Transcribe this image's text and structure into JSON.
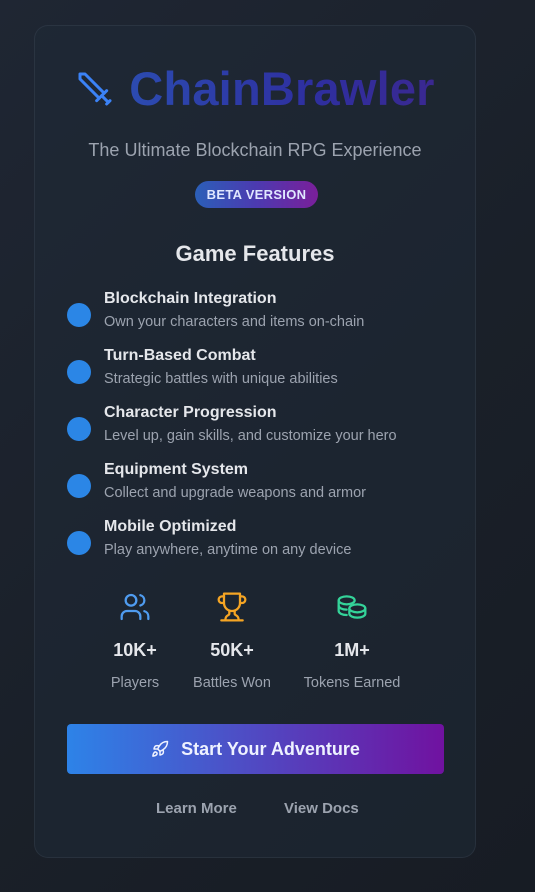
{
  "brand": {
    "name": "ChainBrawler",
    "tagline": "The Ultimate Blockchain RPG Experience",
    "badge": "BETA VERSION",
    "icon": "sword-icon"
  },
  "features": {
    "title": "Game Features",
    "items": [
      {
        "title": "Blockchain Integration",
        "description": "Own your characters and items on-chain"
      },
      {
        "title": "Turn-Based Combat",
        "description": "Strategic battles with unique abilities"
      },
      {
        "title": "Character Progression",
        "description": "Level up, gain skills, and customize your hero"
      },
      {
        "title": "Equipment System",
        "description": "Collect and upgrade weapons and armor"
      },
      {
        "title": "Mobile Optimized",
        "description": "Play anywhere, anytime on any device"
      }
    ]
  },
  "stats": [
    {
      "icon": "users-icon",
      "value": "10K+",
      "label": "Players",
      "color": "#4f9cf0"
    },
    {
      "icon": "trophy-icon",
      "value": "50K+",
      "label": "Battles Won",
      "color": "#f5a524"
    },
    {
      "icon": "coins-icon",
      "value": "1M+",
      "label": "Tokens Earned",
      "color": "#34d399"
    }
  ],
  "cta": {
    "label": "Start Your Adventure",
    "icon": "rocket-icon"
  },
  "links": {
    "learn_more": "Learn More",
    "view_docs": "View Docs"
  },
  "colors": {
    "accent_blue": "#2b86e6",
    "accent_purple": "#7012a0",
    "background": "#1c222c"
  }
}
